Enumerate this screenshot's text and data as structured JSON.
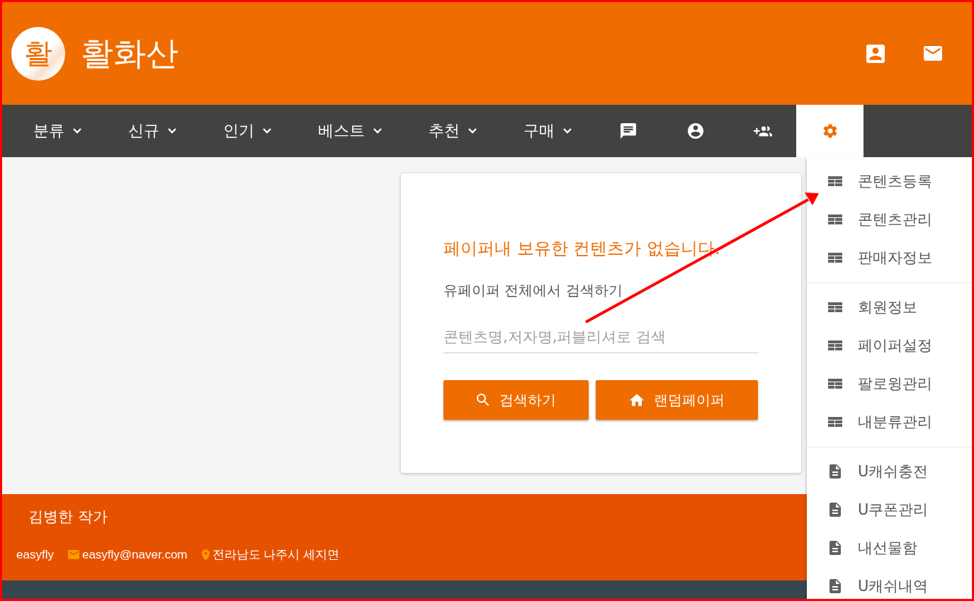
{
  "header": {
    "logo": "활",
    "title": "활화산"
  },
  "nav": {
    "items": [
      {
        "kind": "menu",
        "label": "분류",
        "selected": false
      },
      {
        "kind": "menu",
        "label": "신규",
        "selected": false
      },
      {
        "kind": "menu",
        "label": "인기",
        "selected": false
      },
      {
        "kind": "menu",
        "label": "베스트",
        "selected": false
      },
      {
        "kind": "menu",
        "label": "추천",
        "selected": false
      },
      {
        "kind": "menu",
        "label": "구매",
        "selected": false
      },
      {
        "kind": "chat",
        "selected": false
      },
      {
        "kind": "account",
        "selected": false
      },
      {
        "kind": "group-add",
        "selected": false
      },
      {
        "kind": "settings",
        "selected": true
      }
    ]
  },
  "settings_menu": {
    "groups": [
      [
        {
          "kind": "table",
          "label": "콘텐츠등록"
        },
        {
          "kind": "table",
          "label": "콘텐츠관리"
        },
        {
          "kind": "table",
          "label": "판매자정보"
        }
      ],
      [
        {
          "kind": "table",
          "label": "회원정보"
        },
        {
          "kind": "table",
          "label": "페이퍼설정"
        },
        {
          "kind": "table",
          "label": "팔로윙관리"
        },
        {
          "kind": "table",
          "label": "내분류관리"
        }
      ],
      [
        {
          "kind": "doc",
          "label": "U캐쉬충전"
        },
        {
          "kind": "doc",
          "label": "U쿠폰관리"
        },
        {
          "kind": "doc",
          "label": "내선물함"
        },
        {
          "kind": "doc",
          "label": "U캐쉬내역"
        }
      ]
    ]
  },
  "card": {
    "message": "페이퍼내 보유한 컨텐츠가 없습니다.",
    "subtitle": "유페이퍼 전체에서 검색하기",
    "search": {
      "placeholder": "콘텐츠명,저자명,퍼블리셔로 검색"
    },
    "buttons": [
      {
        "kind": "search",
        "label": "검색하기"
      },
      {
        "kind": "home",
        "label": "랜덤페이퍼"
      }
    ]
  },
  "footer": {
    "author": "김병한 작가",
    "user": "easyfly",
    "email": "easyfly@naver.com",
    "address": "전라남도 나주시 세지면"
  }
}
